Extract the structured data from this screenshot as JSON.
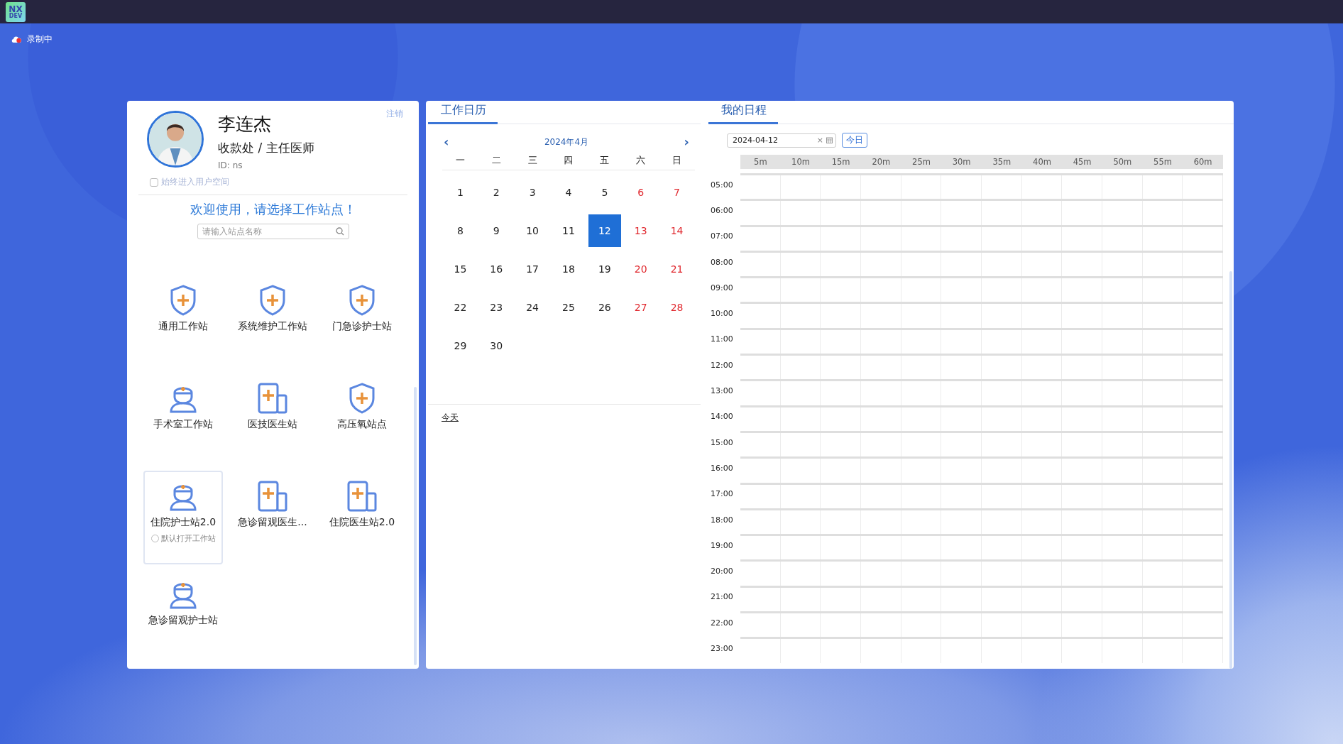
{
  "logo": {
    "line1": "NX",
    "line2": "DEV"
  },
  "recording": {
    "label": "录制中"
  },
  "user": {
    "name": "李连杰",
    "role": "收款处 / 主任医师",
    "id": "ID: ns",
    "logout": "注销",
    "always_enter": {
      "label": "始终进入用户空间",
      "checked": false
    }
  },
  "welcome": "欢迎使用，请选择工作站点！",
  "search": {
    "placeholder": "请输入站点名称"
  },
  "stations": [
    {
      "label": "通用工作站",
      "kind": "shield",
      "selected": false
    },
    {
      "label": "系统维护工作站",
      "kind": "shield",
      "selected": false
    },
    {
      "label": "门急诊护士站",
      "kind": "shield",
      "selected": false
    },
    {
      "label": "手术室工作站",
      "kind": "nurse",
      "selected": false
    },
    {
      "label": "医技医生站",
      "kind": "document",
      "selected": false
    },
    {
      "label": "高压氧站点",
      "kind": "shield",
      "selected": false
    },
    {
      "label": "住院护士站2.0",
      "kind": "nurse",
      "selected": true,
      "default_option": {
        "label": "默认打开工作站",
        "checked": false
      }
    },
    {
      "label": "急诊留观医生...",
      "kind": "document",
      "selected": false
    },
    {
      "label": "住院医生站2.0",
      "kind": "document",
      "selected": false
    },
    {
      "label": "急诊留观护士站",
      "kind": "nurse",
      "selected": false
    }
  ],
  "calendar": {
    "tab": "工作日历",
    "prev": "‹",
    "month": "2024年4月",
    "next": "›",
    "weekdays": [
      "一",
      "二",
      "三",
      "四",
      "五",
      "六",
      "日"
    ],
    "weeks": [
      [
        {
          "day": "1",
          "weekend": false,
          "selected": false
        },
        {
          "day": "2",
          "weekend": false,
          "selected": false
        },
        {
          "day": "3",
          "weekend": false,
          "selected": false
        },
        {
          "day": "4",
          "weekend": false,
          "selected": false
        },
        {
          "day": "5",
          "weekend": false,
          "selected": false
        },
        {
          "day": "6",
          "weekend": true,
          "selected": false
        },
        {
          "day": "7",
          "weekend": true,
          "selected": false
        }
      ],
      [
        {
          "day": "8",
          "weekend": false,
          "selected": false
        },
        {
          "day": "9",
          "weekend": false,
          "selected": false
        },
        {
          "day": "10",
          "weekend": false,
          "selected": false
        },
        {
          "day": "11",
          "weekend": false,
          "selected": false
        },
        {
          "day": "12",
          "weekend": false,
          "selected": true
        },
        {
          "day": "13",
          "weekend": true,
          "selected": false
        },
        {
          "day": "14",
          "weekend": true,
          "selected": false
        }
      ],
      [
        {
          "day": "15",
          "weekend": false,
          "selected": false
        },
        {
          "day": "16",
          "weekend": false,
          "selected": false
        },
        {
          "day": "17",
          "weekend": false,
          "selected": false
        },
        {
          "day": "18",
          "weekend": false,
          "selected": false
        },
        {
          "day": "19",
          "weekend": false,
          "selected": false
        },
        {
          "day": "20",
          "weekend": true,
          "selected": false
        },
        {
          "day": "21",
          "weekend": true,
          "selected": false
        }
      ],
      [
        {
          "day": "22",
          "weekend": false,
          "selected": false
        },
        {
          "day": "23",
          "weekend": false,
          "selected": false
        },
        {
          "day": "24",
          "weekend": false,
          "selected": false
        },
        {
          "day": "25",
          "weekend": false,
          "selected": false
        },
        {
          "day": "26",
          "weekend": false,
          "selected": false
        },
        {
          "day": "27",
          "weekend": true,
          "selected": false
        },
        {
          "day": "28",
          "weekend": true,
          "selected": false
        }
      ],
      [
        {
          "day": "29",
          "weekend": false,
          "selected": false
        },
        {
          "day": "30",
          "weekend": false,
          "selected": false
        }
      ]
    ],
    "today_link": "今天"
  },
  "schedule": {
    "tab": "我的日程",
    "date": "2024-04-12",
    "clear": "×",
    "today_button": "今日",
    "minutes": [
      "5m",
      "10m",
      "15m",
      "20m",
      "25m",
      "30m",
      "35m",
      "40m",
      "45m",
      "50m",
      "55m",
      "60m"
    ],
    "hours": [
      "05:00",
      "06:00",
      "07:00",
      "08:00",
      "09:00",
      "10:00",
      "11:00",
      "12:00",
      "13:00",
      "14:00",
      "15:00",
      "16:00",
      "17:00",
      "18:00",
      "19:00",
      "20:00",
      "21:00",
      "22:00",
      "23:00"
    ]
  }
}
